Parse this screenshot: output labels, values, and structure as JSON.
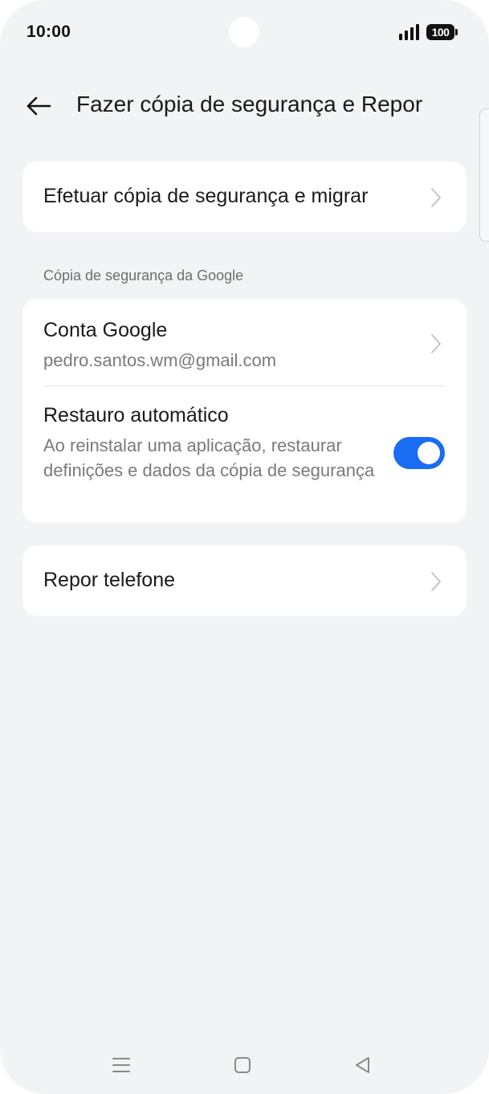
{
  "status_bar": {
    "time": "10:00",
    "battery": "100",
    "signal_icon": "signal-bars-icon"
  },
  "header": {
    "back_icon": "arrow-left-icon",
    "title": "Fazer cópia de segurança e Repor"
  },
  "backup_card": {
    "label": "Efetuar cópia de segurança e migrar"
  },
  "google_section": {
    "label": "Cópia de segurança da Google",
    "account": {
      "title": "Conta Google",
      "email": "pedro.santos.wm@gmail.com"
    },
    "auto_restore": {
      "title": "Restauro automático",
      "description": "Ao reinstalar uma aplicação, restaurar definições e dados da cópia de segurança",
      "enabled": true
    }
  },
  "reset_card": {
    "label": "Repor telefone"
  },
  "nav_bar": {
    "recent_icon": "menu-lines-icon",
    "home_icon": "square-home-icon",
    "back_icon": "triangle-back-icon"
  },
  "colors": {
    "accent": "#1a6cf2",
    "background": "#f2f3f5",
    "card": "#ffffff"
  }
}
